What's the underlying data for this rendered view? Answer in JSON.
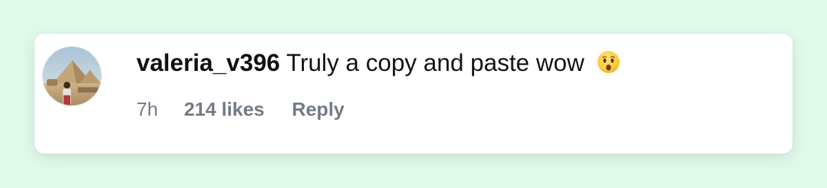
{
  "comment": {
    "username": "valeria_v396",
    "text": "Truly a copy and paste wow",
    "emoji": "surprised-face-emoji",
    "time": "7h",
    "likes": "214 likes",
    "reply_label": "Reply"
  },
  "colors": {
    "page_background": "#e0f9e9",
    "card_background": "#ffffff",
    "text_primary": "#111111",
    "text_secondary": "#737b86"
  }
}
